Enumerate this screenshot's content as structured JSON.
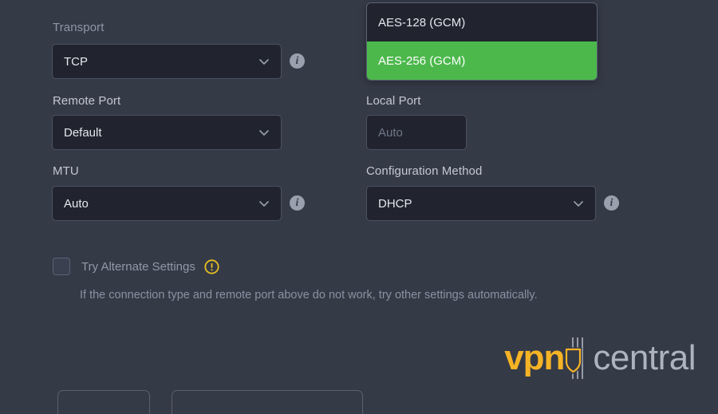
{
  "theme": {
    "background": "#353a47",
    "field_background": "#21242e",
    "field_border": "#4a5162",
    "accent_green": "#4cb84c",
    "accent_yellow": "#f5b325",
    "label_color": "#c3c8d2",
    "muted_color": "#8f96a6"
  },
  "form": {
    "transport": {
      "label": "Transport",
      "value": "TCP",
      "chevron_icon": "chevron-down-icon",
      "info_icon": "i"
    },
    "remote_port": {
      "label": "Remote Port",
      "value": "Default",
      "chevron_icon": "chevron-down-icon"
    },
    "local_port": {
      "label": "Local Port",
      "placeholder": "Auto",
      "value": ""
    },
    "mtu": {
      "label": "MTU",
      "value": "Auto",
      "chevron_icon": "chevron-down-icon",
      "info_icon": "i"
    },
    "configuration_method": {
      "label": "Configuration Method",
      "value": "DHCP",
      "chevron_icon": "chevron-down-icon",
      "info_icon": "i"
    }
  },
  "cipher_dropdown": {
    "open": true,
    "options": [
      {
        "label": "AES-128 (GCM)",
        "selected": false
      },
      {
        "label": "AES-256 (GCM)",
        "selected": true
      }
    ]
  },
  "alternate_settings": {
    "checkbox_label": "Try Alternate Settings",
    "checked": false,
    "warning_icon": "warning-exclamation-icon",
    "help_text": "If the connection type and remote port above do not work, try other settings automatically."
  },
  "logo": {
    "primary": "vpn",
    "secondary": "central",
    "mark_icon": "shield-icon"
  },
  "footer_buttons": [
    {
      "label": ""
    },
    {
      "label": ""
    }
  ]
}
